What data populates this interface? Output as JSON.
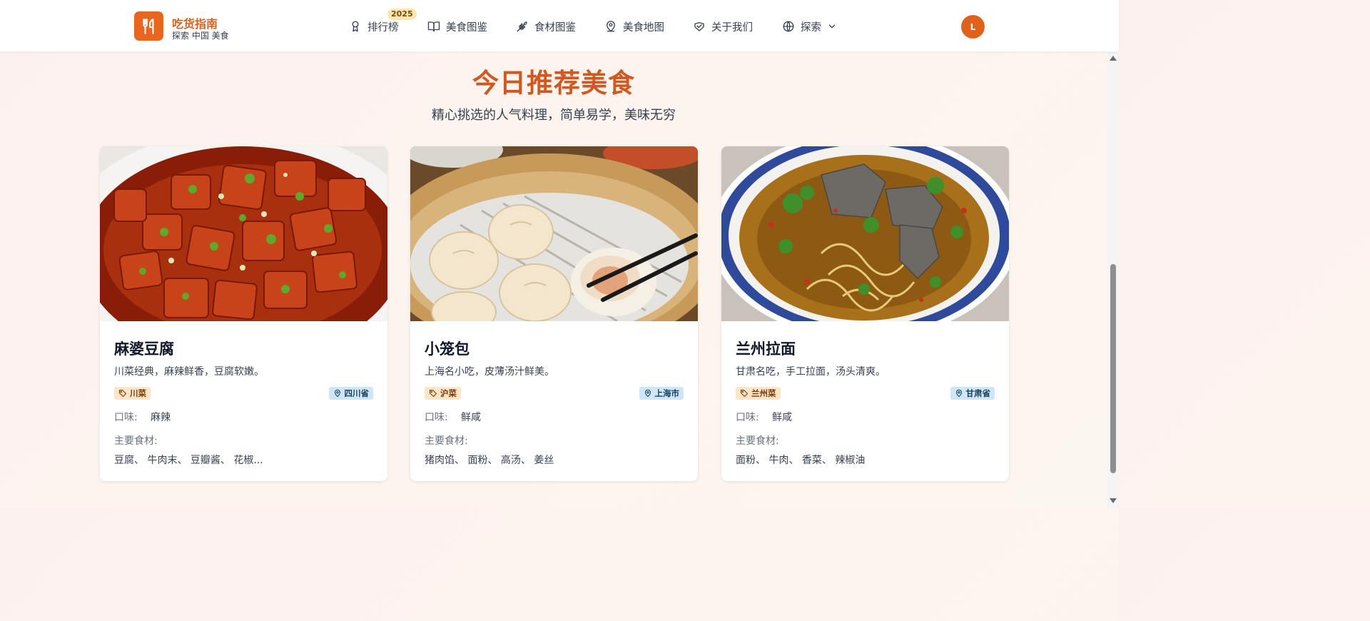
{
  "brand": {
    "title": "吃货指南",
    "subtitle": "探索 中国 美食",
    "accent": "#e8651f",
    "icon": "fork-knife-icon"
  },
  "nav": {
    "items": [
      {
        "label": "排行榜",
        "icon": "award-icon",
        "badge": "2025"
      },
      {
        "label": "美食图鉴",
        "icon": "book-open-icon"
      },
      {
        "label": "食材图鉴",
        "icon": "wheat-icon"
      },
      {
        "label": "美食地图",
        "icon": "map-pin-user-icon"
      },
      {
        "label": "关于我们",
        "icon": "handshake-icon"
      },
      {
        "label": "探索",
        "icon": "globe-icon",
        "dropdown": "chevron-down-icon"
      }
    ],
    "avatar_initial": "L"
  },
  "section": {
    "title": "今日推荐美食",
    "subtitle": "精心挑选的人气料理，简单易学，美味无穷"
  },
  "labels": {
    "taste": "口味:",
    "ingredients": "主要食材:"
  },
  "dishes": [
    {
      "name": "麻婆豆腐",
      "description": "川菜经典，麻辣鲜香，豆腐软嫩。",
      "cuisine": "川菜",
      "region": "四川省",
      "taste": "麻辣",
      "ingredients": "豆腐、 牛肉末、 豆瓣酱、 花椒..."
    },
    {
      "name": "小笼包",
      "description": "上海名小吃，皮薄汤汁鲜美。",
      "cuisine": "沪菜",
      "region": "上海市",
      "taste": "鲜咸",
      "ingredients": "猪肉馅、 面粉、 高汤、 姜丝"
    },
    {
      "name": "兰州拉面",
      "description": "甘肃名吃，手工拉面，汤头清爽。",
      "cuisine": "兰州菜",
      "region": "甘肃省",
      "taste": "鲜咸",
      "ingredients": "面粉、 牛肉、 香菜、 辣椒油"
    }
  ],
  "colors": {
    "title": "#d2581f",
    "cuisine_tag_bg": "#fde6c8",
    "region_tag_bg": "#cfe6f7"
  }
}
